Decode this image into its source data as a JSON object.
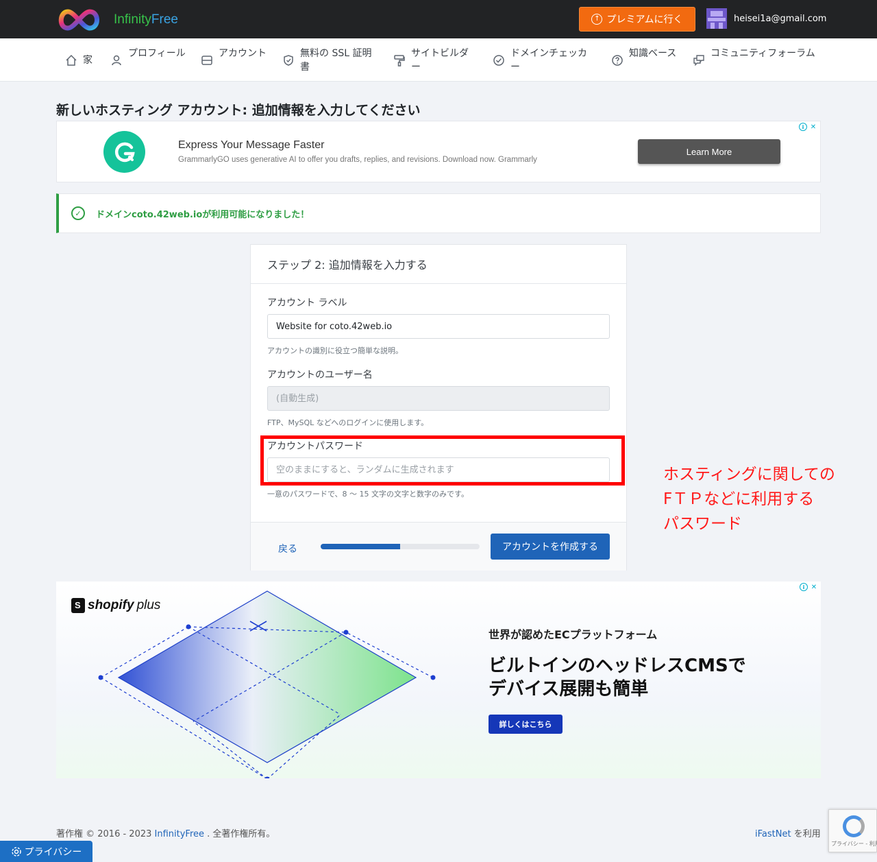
{
  "brand": {
    "name_part1": "Infinity",
    "name_part2": "Free"
  },
  "header": {
    "premium_label": "プレミアムに行く",
    "user_email": "heisei1a@gmail.com"
  },
  "nav": {
    "home": "家",
    "profile": "プロフィール",
    "accounts": "アカウント",
    "ssl": "無料の SSL 証明書",
    "sitebuilder": "サイトビルダー",
    "domain_checker": "ドメインチェッカー",
    "knowledge_base": "知識ベース",
    "community": "コミュニティフォーラム"
  },
  "page_title": "新しいホスティング アカウント: 追加情報を入力してください",
  "ad_grammarly": {
    "headline": "Express Your Message Faster",
    "body": "GrammarlyGO uses generative AI to offer you drafts, replies, and revisions. Download now. Grammarly",
    "button": "Learn More"
  },
  "alert": {
    "message": "ドメインcoto.42web.ioが利用可能になりました！"
  },
  "form": {
    "title": "ステップ 2: 追加情報を入力する",
    "label_field": {
      "label": "アカウント ラベル",
      "value": "Website for coto.42web.io",
      "help": "アカウントの識別に役立つ簡単な説明。"
    },
    "username_field": {
      "label": "アカウントのユーザー名",
      "placeholder": "(自動生成)",
      "help": "FTP、MySQL などへのログインに使用します。"
    },
    "password_field": {
      "label": "アカウントパスワード",
      "placeholder": "空のままにすると、ランダムに生成されます",
      "help": "一意のパスワードで、8 ～ 15 文字の文字と数字のみです。"
    },
    "back_label": "戻る",
    "progress_fraction": 0.5,
    "submit_label": "アカウントを作成する"
  },
  "annotation": {
    "line1": "ホスティングに関しての",
    "line2": "FＴＰなどに利用する",
    "line3": "パスワード",
    "color": "#ff0000"
  },
  "ad_shopify": {
    "brand": "shopify",
    "brand_suffix": "plus",
    "tagline": "世界が認めたECプラットフォーム",
    "headline_line1": "ビルトインのヘッドレスCMSで",
    "headline_line2": "デバイス展開も簡単",
    "cta": "詳しくはこちら"
  },
  "footer": {
    "copyright_prefix": "著作権 © 2016 - 2023 ",
    "copyright_link": "InfinityFree",
    "copyright_suffix": " . 全著作権所有。",
    "powered_link": "iFastNet",
    "powered_suffix": " を利用",
    "privacy_label": "プライバシー",
    "recaptcha_text": "プライバシー - 利用規約"
  }
}
